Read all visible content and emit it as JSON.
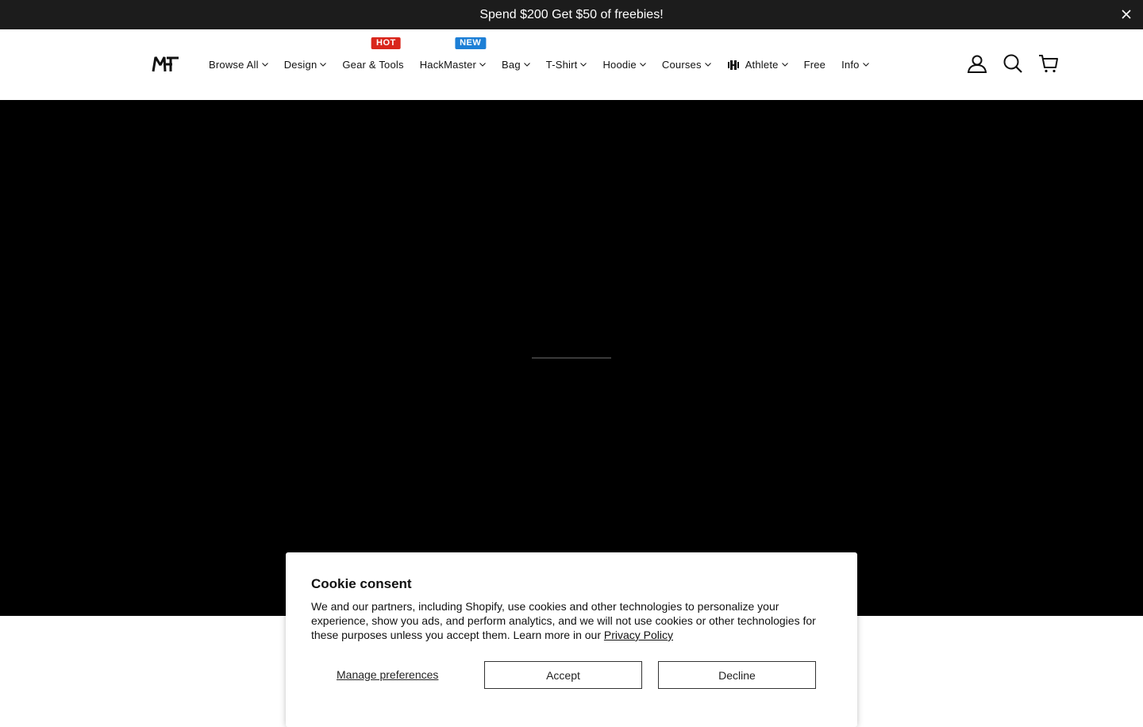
{
  "announcement": {
    "text": "Spend $200 Get $50 of freebies!"
  },
  "header": {
    "logo_icon": "mft-logo-icon",
    "nav": [
      {
        "label": "Browse All",
        "dropdown": true
      },
      {
        "label": "Design",
        "dropdown": true
      },
      {
        "label": "Gear & Tools",
        "dropdown": false,
        "badge": "HOT"
      },
      {
        "label": "HackMaster",
        "dropdown": true,
        "badge": "NEW"
      },
      {
        "label": "Bag",
        "dropdown": true
      },
      {
        "label": "T-Shirt",
        "dropdown": true
      },
      {
        "label": "Hoodie",
        "dropdown": true
      },
      {
        "label": "Courses",
        "dropdown": true
      },
      {
        "label": "Athlete",
        "dropdown": true,
        "icon": "dumbbell-icon"
      },
      {
        "label": "Free",
        "dropdown": false
      },
      {
        "label": "Info",
        "dropdown": true
      }
    ],
    "icons": [
      "account-icon",
      "search-icon",
      "cart-icon"
    ]
  },
  "colors": {
    "announcement_bg": "#1c1c1c",
    "hero_bg": "#000000",
    "hot_badge": "#d9261c",
    "new_badge": "#1d7fd6"
  },
  "cookie": {
    "title": "Cookie consent",
    "body": "We and our partners, including Shopify, use cookies and other technologies to personalize your experience, show you ads, and perform analytics, and we will not use cookies or other technologies for these purposes unless you accept them. Learn more in our ",
    "privacy_link": "Privacy Policy",
    "manage_label": "Manage preferences",
    "accept_label": "Accept",
    "decline_label": "Decline"
  }
}
